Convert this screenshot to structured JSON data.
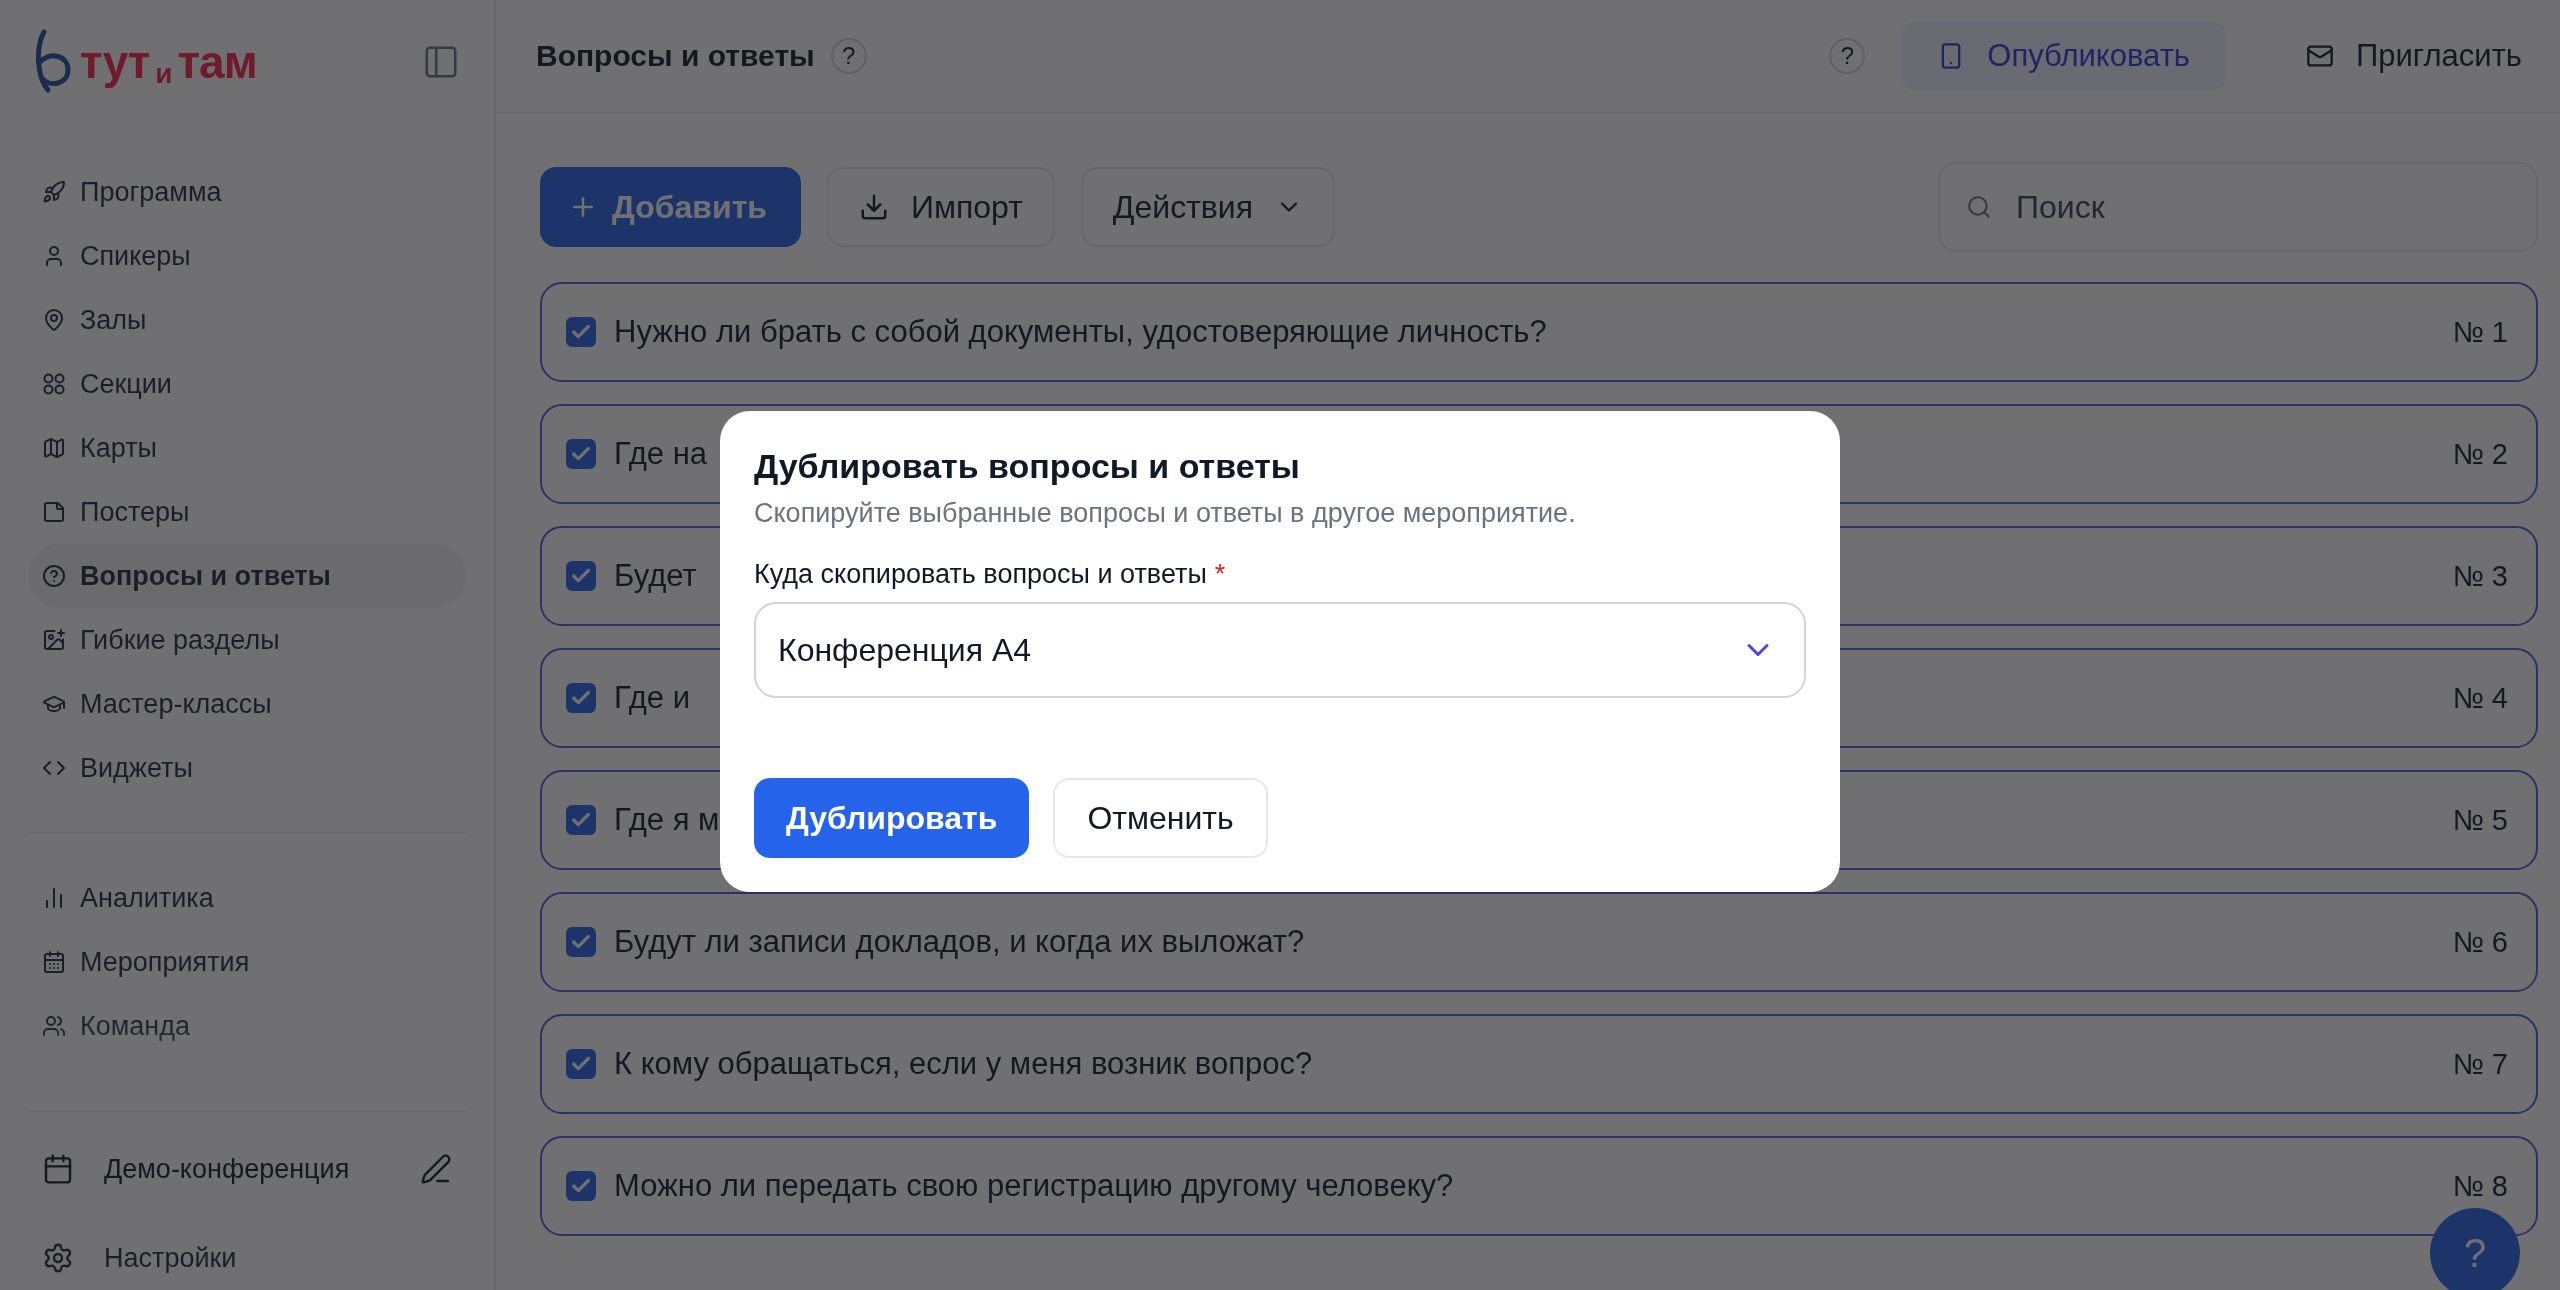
{
  "sidebar": {
    "logo": {
      "start": "тут",
      "middle": "и",
      "end": "там"
    },
    "items": [
      {
        "label": "Программа",
        "selected": false
      },
      {
        "label": "Спикеры",
        "selected": false
      },
      {
        "label": "Залы",
        "selected": false
      },
      {
        "label": "Секции",
        "selected": false
      },
      {
        "label": "Карты",
        "selected": false
      },
      {
        "label": "Постеры",
        "selected": false
      },
      {
        "label": "Вопросы и ответы",
        "selected": true
      },
      {
        "label": "Гибкие разделы",
        "selected": false
      },
      {
        "label": "Мастер-классы",
        "selected": false
      },
      {
        "label": "Виджеты",
        "selected": false
      }
    ],
    "secondary_items": [
      {
        "label": "Аналитика",
        "selected": false
      },
      {
        "label": "Мероприятия",
        "selected": false
      },
      {
        "label": "Команда",
        "selected": false
      }
    ],
    "event": {
      "name": "Демо-конференция"
    },
    "settings": {
      "label": "Настройки"
    }
  },
  "header": {
    "title": "Вопросы и ответы",
    "title_help": "?",
    "help": "?",
    "publish": "Опубликовать",
    "invite": "Пригласить"
  },
  "toolbar": {
    "add": "Добавить",
    "import": "Импорт",
    "actions": "Действия",
    "search": {
      "placeholder": "Поиск"
    }
  },
  "questions": [
    {
      "text": "Нужно ли брать с собой документы, удостоверяющие личность?",
      "checked": true,
      "number": "№ 1"
    },
    {
      "text": "Где на",
      "checked": true,
      "number": "№ 2"
    },
    {
      "text": "Будет",
      "checked": true,
      "number": "№ 3"
    },
    {
      "text": "Где и",
      "checked": true,
      "number": "№ 4"
    },
    {
      "text": "Где я м",
      "checked": true,
      "number": "№ 5"
    },
    {
      "text": "Будут ли записи докладов, и когда их выложат?",
      "checked": true,
      "number": "№ 6"
    },
    {
      "text": "К кому обращаться, если у меня возник вопрос?",
      "checked": true,
      "number": "№ 7"
    },
    {
      "text": "Можно ли передать свою регистрацию другому человеку?",
      "checked": true,
      "number": "№ 8"
    }
  ],
  "modal": {
    "title": "Дублировать вопросы и ответы",
    "description": "Скопируйте выбранные вопросы и ответы в другое мероприятие.",
    "field_label": "Куда скопировать вопросы и ответы",
    "required_mark": "*",
    "field_value": "Конференция А4",
    "confirm": "Дублировать",
    "cancel": "Отменить"
  },
  "help_button": "?"
}
